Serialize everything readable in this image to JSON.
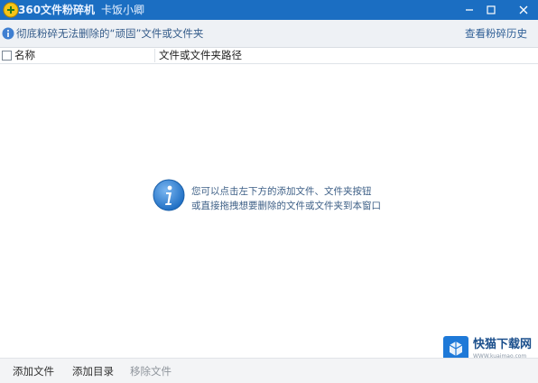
{
  "window": {
    "app_title": "360文件粉碎机",
    "subtitle": "卡饭小卿",
    "controls": [
      "minimize-icon",
      "maximize-icon",
      "close-icon"
    ]
  },
  "infobar": {
    "icon": "info-icon",
    "text": "彻底粉碎无法删除的“顽固”文件或文件夹",
    "history_link": "查看粉碎历史"
  },
  "table": {
    "columns": [
      "名称",
      "文件或文件夹路径"
    ],
    "rows": []
  },
  "empty_state": {
    "icon": "info-icon",
    "line1": "您可以点击左下方的添加文件、文件夹按钮",
    "line2": "或直接拖拽想要删除的文件或文件夹到本窗口"
  },
  "footer": {
    "add_file": "添加文件",
    "add_directory": "添加目录",
    "remove_file": "移除文件"
  },
  "watermark": {
    "name": "快猫下载网",
    "url": "WWW.kuaimao.com"
  },
  "colors": {
    "titlebar": "#1b6ec2",
    "infobar": "#eef1f5",
    "accent_text": "#355c8a"
  }
}
